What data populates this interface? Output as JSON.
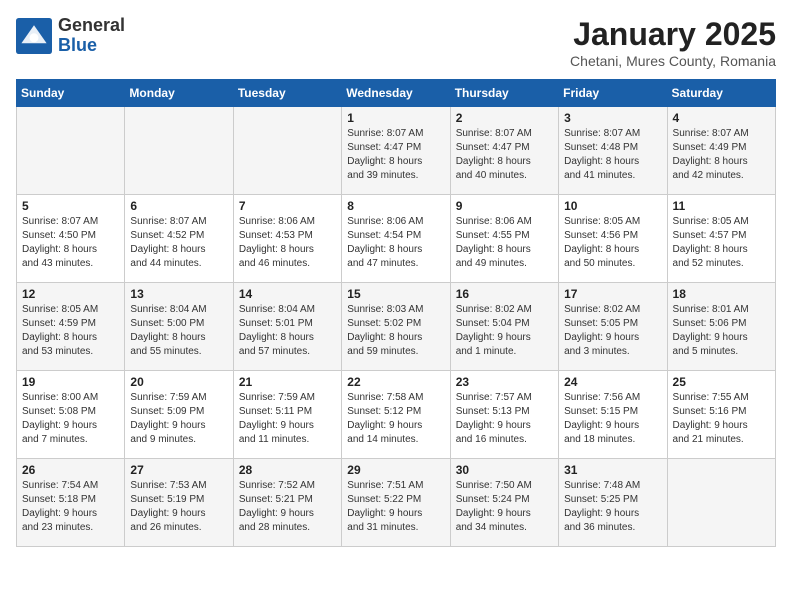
{
  "header": {
    "logo_general": "General",
    "logo_blue": "Blue",
    "month_title": "January 2025",
    "subtitle": "Chetani, Mures County, Romania"
  },
  "days_of_week": [
    "Sunday",
    "Monday",
    "Tuesday",
    "Wednesday",
    "Thursday",
    "Friday",
    "Saturday"
  ],
  "weeks": [
    [
      {
        "day": "",
        "info": ""
      },
      {
        "day": "",
        "info": ""
      },
      {
        "day": "",
        "info": ""
      },
      {
        "day": "1",
        "info": "Sunrise: 8:07 AM\nSunset: 4:47 PM\nDaylight: 8 hours\nand 39 minutes."
      },
      {
        "day": "2",
        "info": "Sunrise: 8:07 AM\nSunset: 4:47 PM\nDaylight: 8 hours\nand 40 minutes."
      },
      {
        "day": "3",
        "info": "Sunrise: 8:07 AM\nSunset: 4:48 PM\nDaylight: 8 hours\nand 41 minutes."
      },
      {
        "day": "4",
        "info": "Sunrise: 8:07 AM\nSunset: 4:49 PM\nDaylight: 8 hours\nand 42 minutes."
      }
    ],
    [
      {
        "day": "5",
        "info": "Sunrise: 8:07 AM\nSunset: 4:50 PM\nDaylight: 8 hours\nand 43 minutes."
      },
      {
        "day": "6",
        "info": "Sunrise: 8:07 AM\nSunset: 4:52 PM\nDaylight: 8 hours\nand 44 minutes."
      },
      {
        "day": "7",
        "info": "Sunrise: 8:06 AM\nSunset: 4:53 PM\nDaylight: 8 hours\nand 46 minutes."
      },
      {
        "day": "8",
        "info": "Sunrise: 8:06 AM\nSunset: 4:54 PM\nDaylight: 8 hours\nand 47 minutes."
      },
      {
        "day": "9",
        "info": "Sunrise: 8:06 AM\nSunset: 4:55 PM\nDaylight: 8 hours\nand 49 minutes."
      },
      {
        "day": "10",
        "info": "Sunrise: 8:05 AM\nSunset: 4:56 PM\nDaylight: 8 hours\nand 50 minutes."
      },
      {
        "day": "11",
        "info": "Sunrise: 8:05 AM\nSunset: 4:57 PM\nDaylight: 8 hours\nand 52 minutes."
      }
    ],
    [
      {
        "day": "12",
        "info": "Sunrise: 8:05 AM\nSunset: 4:59 PM\nDaylight: 8 hours\nand 53 minutes."
      },
      {
        "day": "13",
        "info": "Sunrise: 8:04 AM\nSunset: 5:00 PM\nDaylight: 8 hours\nand 55 minutes."
      },
      {
        "day": "14",
        "info": "Sunrise: 8:04 AM\nSunset: 5:01 PM\nDaylight: 8 hours\nand 57 minutes."
      },
      {
        "day": "15",
        "info": "Sunrise: 8:03 AM\nSunset: 5:02 PM\nDaylight: 8 hours\nand 59 minutes."
      },
      {
        "day": "16",
        "info": "Sunrise: 8:02 AM\nSunset: 5:04 PM\nDaylight: 9 hours\nand 1 minute."
      },
      {
        "day": "17",
        "info": "Sunrise: 8:02 AM\nSunset: 5:05 PM\nDaylight: 9 hours\nand 3 minutes."
      },
      {
        "day": "18",
        "info": "Sunrise: 8:01 AM\nSunset: 5:06 PM\nDaylight: 9 hours\nand 5 minutes."
      }
    ],
    [
      {
        "day": "19",
        "info": "Sunrise: 8:00 AM\nSunset: 5:08 PM\nDaylight: 9 hours\nand 7 minutes."
      },
      {
        "day": "20",
        "info": "Sunrise: 7:59 AM\nSunset: 5:09 PM\nDaylight: 9 hours\nand 9 minutes."
      },
      {
        "day": "21",
        "info": "Sunrise: 7:59 AM\nSunset: 5:11 PM\nDaylight: 9 hours\nand 11 minutes."
      },
      {
        "day": "22",
        "info": "Sunrise: 7:58 AM\nSunset: 5:12 PM\nDaylight: 9 hours\nand 14 minutes."
      },
      {
        "day": "23",
        "info": "Sunrise: 7:57 AM\nSunset: 5:13 PM\nDaylight: 9 hours\nand 16 minutes."
      },
      {
        "day": "24",
        "info": "Sunrise: 7:56 AM\nSunset: 5:15 PM\nDaylight: 9 hours\nand 18 minutes."
      },
      {
        "day": "25",
        "info": "Sunrise: 7:55 AM\nSunset: 5:16 PM\nDaylight: 9 hours\nand 21 minutes."
      }
    ],
    [
      {
        "day": "26",
        "info": "Sunrise: 7:54 AM\nSunset: 5:18 PM\nDaylight: 9 hours\nand 23 minutes."
      },
      {
        "day": "27",
        "info": "Sunrise: 7:53 AM\nSunset: 5:19 PM\nDaylight: 9 hours\nand 26 minutes."
      },
      {
        "day": "28",
        "info": "Sunrise: 7:52 AM\nSunset: 5:21 PM\nDaylight: 9 hours\nand 28 minutes."
      },
      {
        "day": "29",
        "info": "Sunrise: 7:51 AM\nSunset: 5:22 PM\nDaylight: 9 hours\nand 31 minutes."
      },
      {
        "day": "30",
        "info": "Sunrise: 7:50 AM\nSunset: 5:24 PM\nDaylight: 9 hours\nand 34 minutes."
      },
      {
        "day": "31",
        "info": "Sunrise: 7:48 AM\nSunset: 5:25 PM\nDaylight: 9 hours\nand 36 minutes."
      },
      {
        "day": "",
        "info": ""
      }
    ]
  ]
}
